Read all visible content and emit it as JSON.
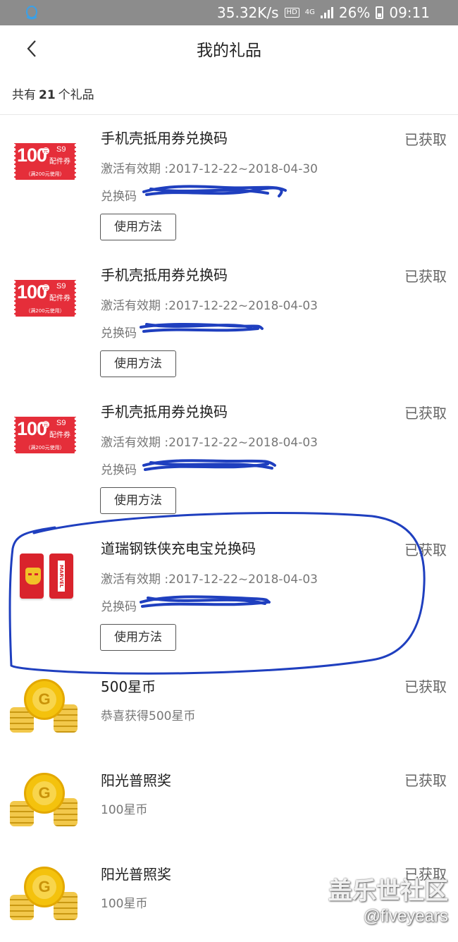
{
  "status_bar": {
    "speed": "35.32K/s",
    "hd": "HD",
    "network": "4G",
    "battery": "26%",
    "time": "09:11"
  },
  "header": {
    "title": "我的礼品"
  },
  "summary": {
    "prefix": "共有",
    "count": "21",
    "suffix": "个礼品"
  },
  "gifts": [
    {
      "name": "手机壳抵用券兑换码",
      "status": "已获取",
      "validity": "激活有效期 :2017-12-22~2018-04-30",
      "code_label": "兑换码",
      "button": "使用方法",
      "icon": "coupon-100-icon"
    },
    {
      "name": "手机壳抵用券兑换码",
      "status": "已获取",
      "validity": "激活有效期 :2017-12-22~2018-04-03",
      "code_label": "兑换码",
      "button": "使用方法",
      "icon": "coupon-100-icon"
    },
    {
      "name": "手机壳抵用券兑换码",
      "status": "已获取",
      "validity": "激活有效期 :2017-12-22~2018-04-03",
      "code_label": "兑换码",
      "button": "使用方法",
      "icon": "coupon-100-icon"
    },
    {
      "name": "道瑞钢铁侠充电宝兑换码",
      "status": "已获取",
      "validity": "激活有效期 :2017-12-22~2018-04-03",
      "code_label": "兑换码",
      "button": "使用方法",
      "icon": "iron-man-power-bank-icon"
    },
    {
      "name": "500星币",
      "status": "已获取",
      "desc": "恭喜获得500星币",
      "icon": "gold-coin-icon"
    },
    {
      "name": "阳光普照奖",
      "status": "已获取",
      "desc": "100星币",
      "icon": "gold-coin-icon"
    },
    {
      "name": "阳光普照奖",
      "status": "已获取",
      "desc": "100星币",
      "icon": "gold-coin-icon"
    }
  ],
  "coupon": {
    "amount": "100",
    "yuan": "元",
    "model": "S9",
    "type": "配件券",
    "condition": "（满200元使用）"
  },
  "power_bank": {
    "brand": "MARVEL"
  },
  "coin": {
    "letter": "G"
  },
  "watermark": {
    "site": "盖乐世社区",
    "handle": "@fiveyears"
  },
  "colors": {
    "coupon_red": "#e52e3a",
    "coin_gold": "#f4c20d",
    "annotation_blue": "#1f3fbf"
  }
}
